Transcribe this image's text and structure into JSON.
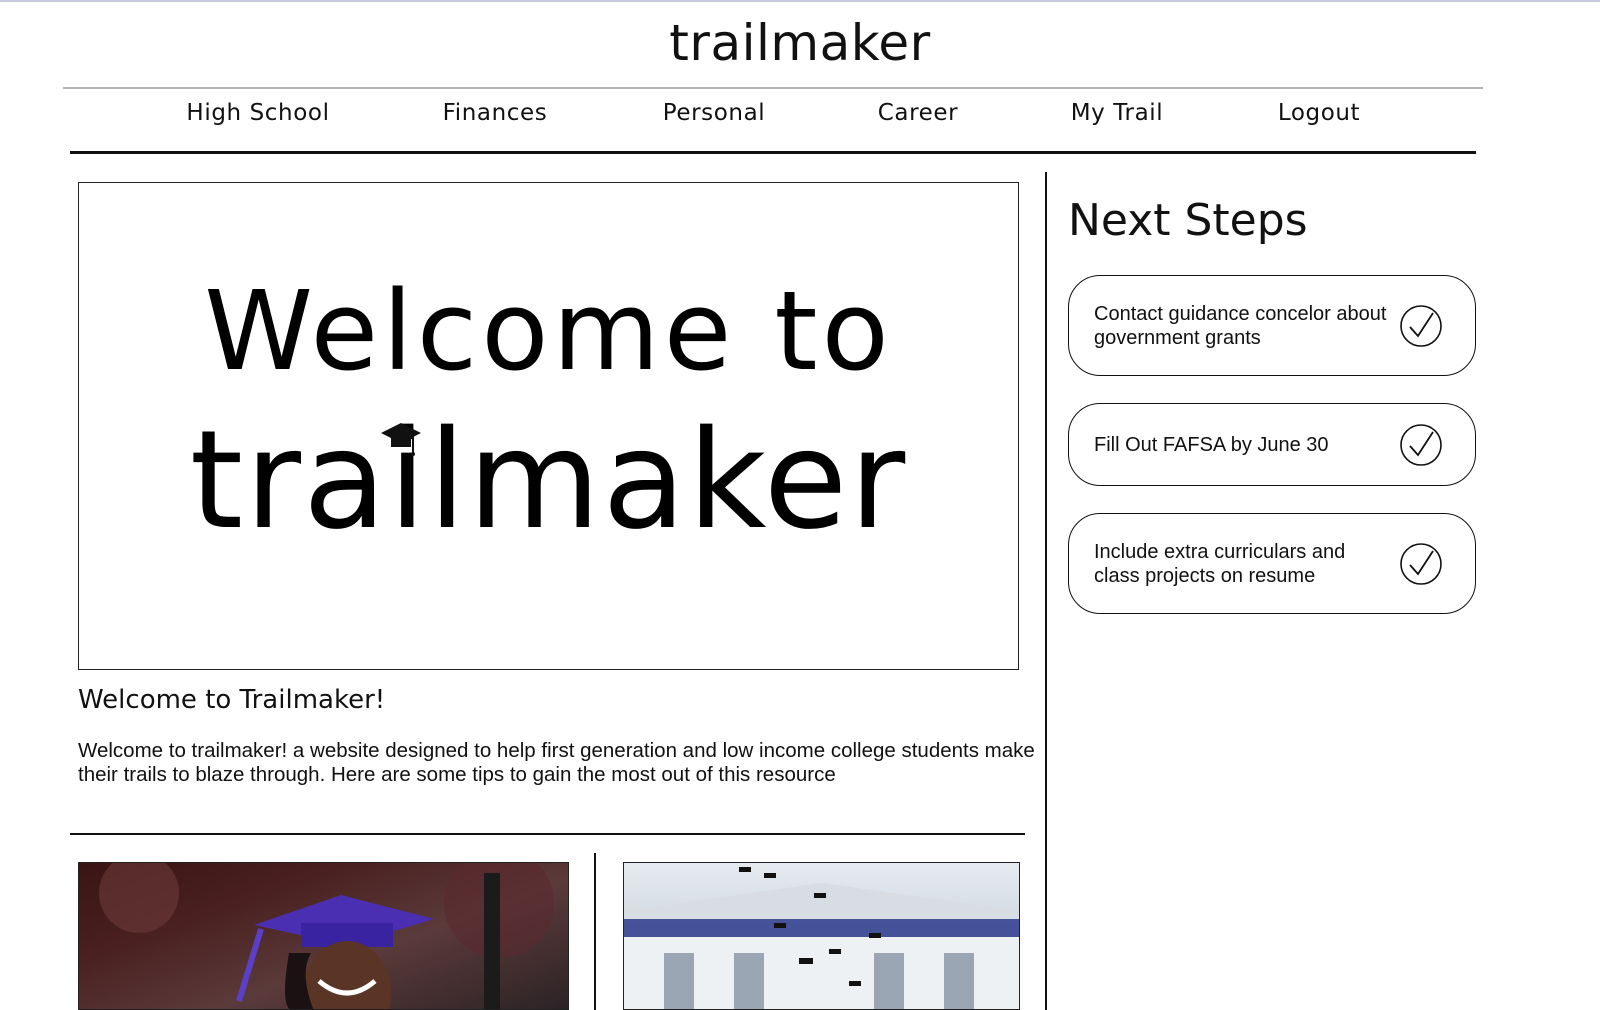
{
  "header": {
    "logo_text": "trailmaker"
  },
  "nav": {
    "items": [
      {
        "label": "High School"
      },
      {
        "label": "Finances"
      },
      {
        "label": "Personal"
      },
      {
        "label": "Career"
      },
      {
        "label": "My Trail"
      },
      {
        "label": "Logout"
      }
    ]
  },
  "hero": {
    "line1": "Welcome to",
    "line2": "trailmaker"
  },
  "welcome": {
    "title": "Welcome to Trailmaker!",
    "body": "Welcome to trailmaker! a website designed to help first generation and low income college students make their trails to blaze through. Here are some tips to gain the most out of this resource"
  },
  "next_steps": {
    "title": "Next Steps",
    "items": [
      {
        "text": "Contact guidance concelor about government grants",
        "icon": "check-circle-icon"
      },
      {
        "text": "Fill Out FAFSA by June 30",
        "icon": "check-circle-icon"
      },
      {
        "text": "Include extra curriculars and class projects on resume",
        "icon": "check-circle-icon"
      }
    ]
  },
  "colors": {
    "accent_cap": "#4b2fb3",
    "rule": "#111111"
  }
}
